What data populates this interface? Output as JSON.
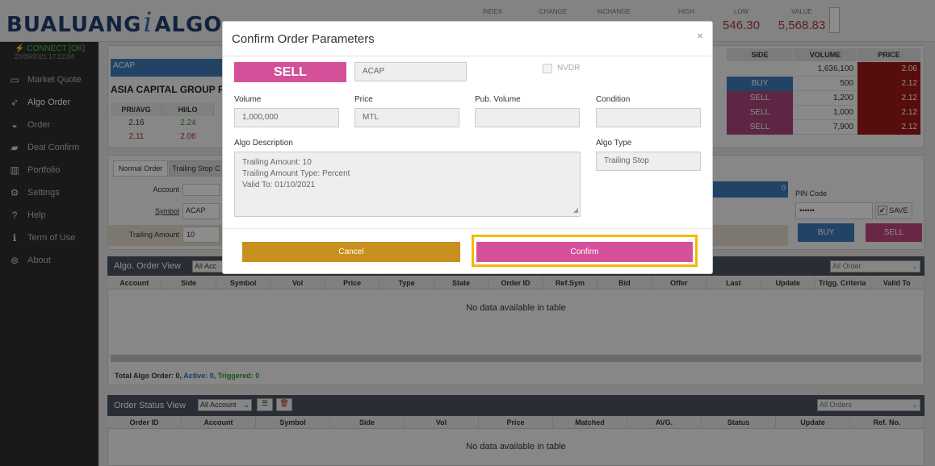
{
  "header": {
    "logo_left": "BUALUANG",
    "logo_mid": "i",
    "logo_right": "ALGO",
    "cols": [
      {
        "label": "INDEX",
        "value": ""
      },
      {
        "label": "CHANGE",
        "value": ""
      },
      {
        "label": "%CHANGE",
        "value": ""
      },
      {
        "label": "HIGH",
        "value": ""
      },
      {
        "label": "LOW",
        "value": "546.30"
      },
      {
        "label": "VALUE",
        "value": "5,568.83"
      }
    ]
  },
  "sidebar": {
    "connect": "CONNECT [OK]",
    "time": "20/09/2021 17:12:04",
    "items": [
      {
        "label": "Market Quote",
        "icon": "monitor-icon"
      },
      {
        "label": "Algo Order",
        "icon": "rocket-icon"
      },
      {
        "label": "Order",
        "icon": "inbox-icon"
      },
      {
        "label": "Deal Confirm",
        "icon": "briefcase-icon"
      },
      {
        "label": "Portfolio",
        "icon": "chart-icon"
      },
      {
        "label": "Settings",
        "icon": "gear-icon"
      },
      {
        "label": "Help",
        "icon": "question-icon"
      },
      {
        "label": "Term of Use",
        "icon": "info-icon"
      },
      {
        "label": "About",
        "icon": "globe-icon"
      }
    ]
  },
  "quote": {
    "symbol": "ACAP",
    "name": "ASIA CAPITAL GROUP PU",
    "headers": [
      "PRI/AVG",
      "HI/LO"
    ],
    "rows": [
      [
        "2.16",
        "2.24"
      ],
      [
        "2.11",
        "2.06"
      ]
    ]
  },
  "ticker_table": {
    "headers": [
      "SIDE",
      "VOLUME",
      "PRICE"
    ],
    "rows": [
      {
        "side": "",
        "volume": "1,636,100",
        "price": "2.06"
      },
      {
        "side": "BUY",
        "volume": "500",
        "price": "2.12"
      },
      {
        "side": "SELL",
        "volume": "1,200",
        "price": "2.12"
      },
      {
        "side": "SELL",
        "volume": "1,000",
        "price": "2.12"
      },
      {
        "side": "SELL",
        "volume": "7,900",
        "price": "2.12"
      }
    ]
  },
  "order_form": {
    "tabs": [
      "Normal Order",
      "Trailing Stop C"
    ],
    "account_label": "Account",
    "symbol_label": "Symbol",
    "symbol_value": "ACAP",
    "trailing_label": "Trailing Amount",
    "trailing_value": "10",
    "progress_value": "0",
    "pin_label": "PIN Code",
    "pin_value": "••••••",
    "save_label": "SAVE",
    "buy_label": "BUY",
    "sell_label": "SELL"
  },
  "algo_view": {
    "title": "Algo. Order View",
    "filter": "All Acc",
    "right_filter": "All Order",
    "columns": [
      "Account",
      "Side",
      "Symbol",
      "Vol",
      "Price",
      "Type",
      "State",
      "Order ID",
      "Ref.Sym",
      "Bid",
      "Offer",
      "Last",
      "Update",
      "Trigg. Criteria",
      "Valid To"
    ],
    "empty": "No data available in table",
    "total_label": "Total Algo Order: 0,",
    "active_label": "Active: 0,",
    "triggered_label": "Triggered: 0"
  },
  "status_view": {
    "title": "Order Status View",
    "filter": "All Account",
    "right_filter": "All Orders",
    "columns": [
      "Order ID",
      "Account",
      "Symbol",
      "Side",
      "Vol",
      "Price",
      "Matched",
      "AVG.",
      "Status",
      "Update",
      "Ref. No."
    ],
    "empty": "No data available in table"
  },
  "modal": {
    "title": "Confirm Order Parameters",
    "close": "×",
    "side": "SELL",
    "symbol": "ACAP",
    "nvdr_label": "NVDR",
    "volume_label": "Volume",
    "volume_value": "1,000,000",
    "price_label": "Price",
    "price_value": "MTL",
    "pub_volume_label": "Pub. Volume",
    "pub_volume_value": "",
    "condition_label": "Condition",
    "condition_value": "",
    "algo_desc_label": "Algo Description",
    "algo_desc_lines": [
      "Trailing Amount: 10",
      "Trailing Amount Type: Percent",
      "Valid To: 01/10/2021"
    ],
    "algo_type_label": "Algo Type",
    "algo_type_value": "Trailing Stop",
    "cancel_label": "Cancel",
    "confirm_label": "Confirm",
    "colors": {
      "sell": "#d4519a",
      "cancel": "#c8901e",
      "highlight": "#f5b800"
    }
  }
}
